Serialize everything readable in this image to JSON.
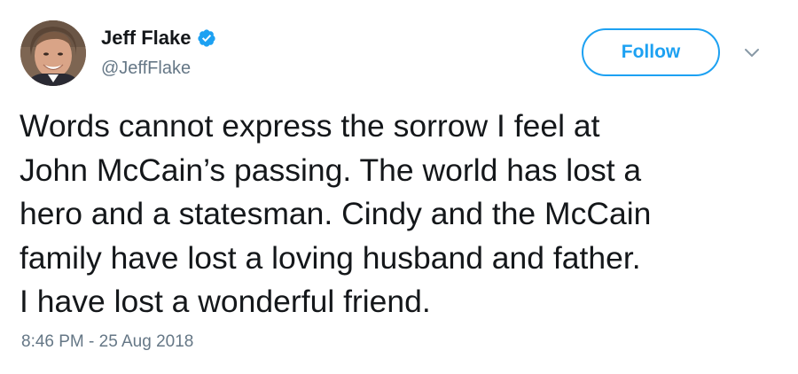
{
  "author": {
    "display_name": "Jeff Flake",
    "handle": "@JeffFlake",
    "verified": true,
    "avatar_icon": "avatar-photo"
  },
  "actions": {
    "follow_label": "Follow",
    "menu_icon": "chevron-down-icon"
  },
  "tweet": {
    "text": "Words cannot express the sorrow I feel at\nJohn McCain’s passing. The world has lost a\nhero and a statesman. Cindy and the McCain\nfamily have lost a loving husband and father.\nI have lost a wonderful friend.",
    "timestamp": "8:46 PM - 25 Aug 2018"
  },
  "colors": {
    "accent": "#1da1f2",
    "text": "#14171a",
    "muted": "#657786",
    "background": "#ffffff"
  }
}
